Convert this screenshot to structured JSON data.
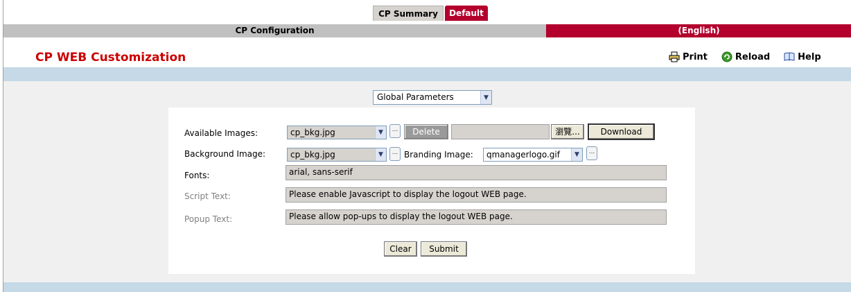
{
  "tabs": [
    {
      "label": "CP Summary"
    },
    {
      "label": "Default"
    }
  ],
  "header_bar": {
    "left": "CP Configuration",
    "right": "(English)"
  },
  "page_title": "CP WEB Customization",
  "actions": {
    "print": "Print",
    "reload": "Reload",
    "help": "Help"
  },
  "scope_select": {
    "value": "Global Parameters"
  },
  "form": {
    "available_images_label": "Available Images:",
    "available_images_value": "cp_bkg.jpg",
    "browse_label": "...",
    "delete_label": "Delete",
    "file_browse_label": "瀏覽...",
    "download_label": "Download",
    "background_image_label": "Background Image:",
    "background_image_value": "cp_bkg.jpg",
    "branding_image_label": "Branding Image:",
    "branding_image_value": "qmanagerlogo.gif",
    "fonts_label": "Fonts:",
    "fonts_value": "arial, sans-serif",
    "script_text_label": "Script Text:",
    "script_text_value": "Please enable Javascript to display the logout WEB page.",
    "popup_text_label": "Popup Text:",
    "popup_text_value": "Please allow pop-ups to display the logout WEB page.",
    "clear_label": "Clear",
    "submit_label": "Submit"
  }
}
